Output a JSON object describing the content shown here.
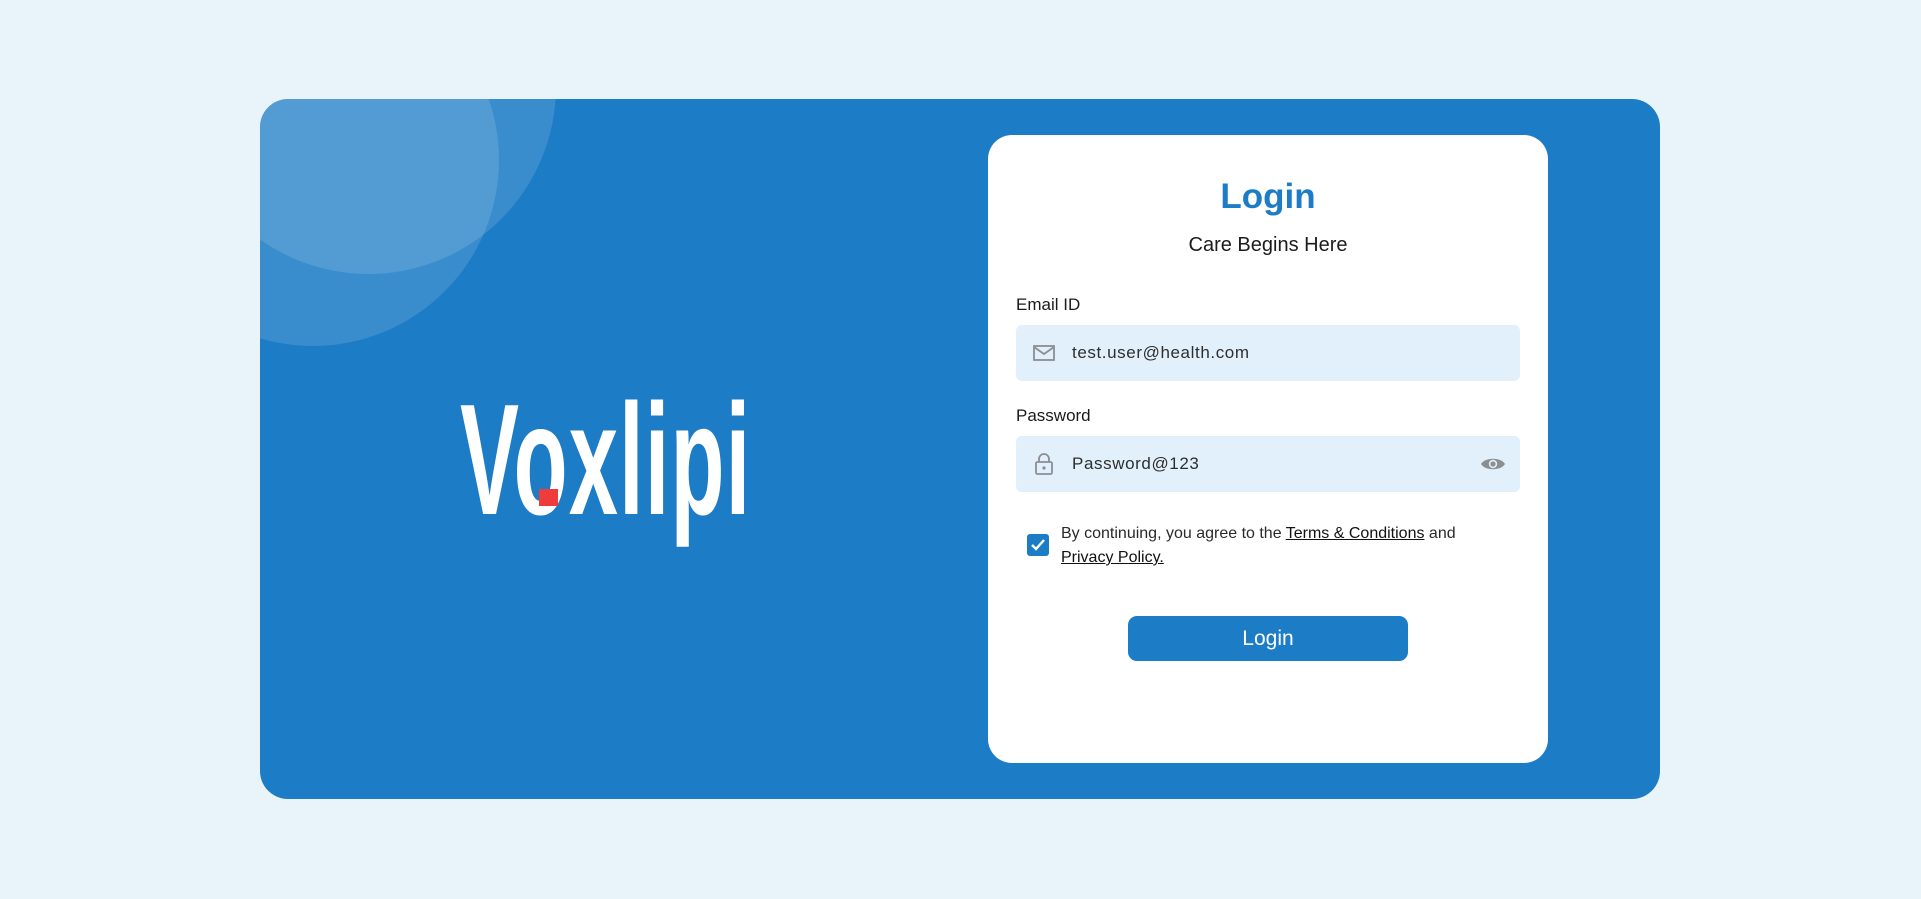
{
  "brand": {
    "logo_text": "Voxlipi",
    "accent_color": "#ef3b3b",
    "panel_color": "#1d7cc6"
  },
  "login": {
    "title": "Login",
    "subtitle": "Care Begins Here",
    "email": {
      "label": "Email ID",
      "value": "test.user@health.com",
      "icon": "mail-icon"
    },
    "password": {
      "label": "Password",
      "value": "Password@123",
      "icon": "lock-icon",
      "toggle_icon": "eye-icon"
    },
    "consent": {
      "checked": true,
      "prefix": "By continuing, you agree to the ",
      "terms_link": "Terms & Conditions",
      "middle": " and ",
      "privacy_link": "Privacy Policy."
    },
    "button_label": "Login"
  }
}
